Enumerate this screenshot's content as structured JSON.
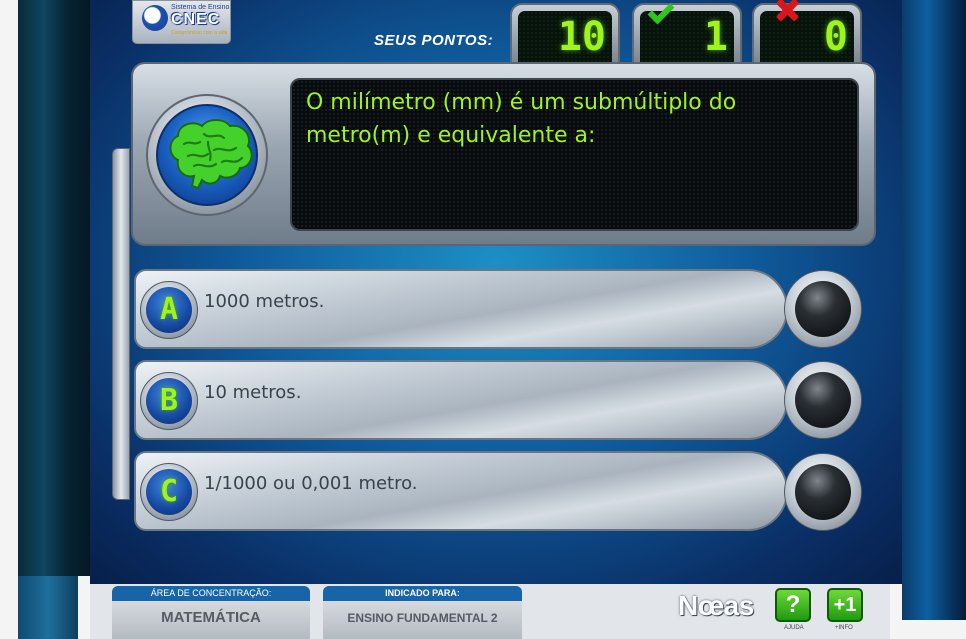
{
  "logo": {
    "top_text": "Sistema de Ensino",
    "name": "CNEC",
    "tagline": "Compromisso com a vida"
  },
  "scoreboard": {
    "label": "SEUS PONTOS:",
    "points": "10",
    "correct": "1",
    "wrong": "0"
  },
  "question": {
    "text": "O milímetro (mm) é um submúltiplo do metro(m) e equivalente a:"
  },
  "options": [
    {
      "letter": "A",
      "text": "1000 metros."
    },
    {
      "letter": "B",
      "text": "10 metros."
    },
    {
      "letter": "C",
      "text": "1/1000 ou 0,001 metro."
    }
  ],
  "footer": {
    "area_label": "ÁREA DE CONCENTRAÇÃO:",
    "area_value": "MATEMÁTICA",
    "audience_label": "INDICADO PARA:",
    "audience_value": "ENSINO FUNDAMENTAL 2",
    "brand": "Nœas",
    "help_label": "?",
    "help_caption": "AJUDA",
    "hint_label": "+1",
    "hint_caption": "+INFO"
  },
  "colors": {
    "led_green": "#9ef41c",
    "stage_blue": "#0f5a9a",
    "header_blue": "#1565a8"
  }
}
